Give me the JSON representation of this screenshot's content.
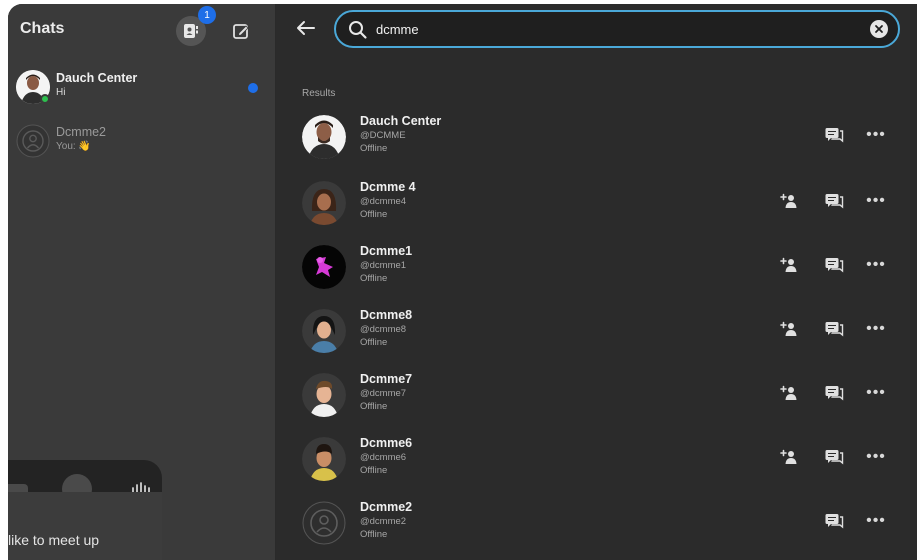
{
  "sidebar": {
    "title": "Chats",
    "contacts_badge": "1",
    "chats": [
      {
        "name": "Dauch Center",
        "preview": "Hi",
        "online": true,
        "unread": true
      },
      {
        "name": "Dcmme2",
        "preview": "You: 👋",
        "online": false,
        "unread": false
      }
    ]
  },
  "search": {
    "value": "dcmme",
    "results_label": "Results",
    "results": [
      {
        "name": "Dauch Center",
        "handle": "@DCMME",
        "status": "Offline",
        "avatar": "photo-man",
        "can_add": false
      },
      {
        "name": "Dcmme 4",
        "handle": "@dcmme4",
        "status": "Offline",
        "avatar": "avatar-woman-dark",
        "can_add": true
      },
      {
        "name": "Dcmme1",
        "handle": "@dcmme1",
        "status": "Offline",
        "avatar": "pink-logo",
        "can_add": true
      },
      {
        "name": "Dcmme8",
        "handle": "@dcmme8",
        "status": "Offline",
        "avatar": "avatar-woman-black-hair",
        "can_add": true
      },
      {
        "name": "Dcmme7",
        "handle": "@dcmme7",
        "status": "Offline",
        "avatar": "avatar-man-brown-hair",
        "can_add": true
      },
      {
        "name": "Dcmme6",
        "handle": "@dcmme6",
        "status": "Offline",
        "avatar": "avatar-man-dark-hair",
        "can_add": true
      },
      {
        "name": "Dcmme2",
        "handle": "@dcmme2",
        "status": "Offline",
        "avatar": "default-person",
        "can_add": false
      }
    ]
  },
  "overlay": {
    "message_fragment": "like to meet up"
  },
  "colors": {
    "accent_blue": "#1e6ee8",
    "search_border": "#4aa8d8",
    "online_green": "#2dbf4e",
    "sidebar_bg": "#3a3a3a",
    "main_bg": "#2b2b2b"
  }
}
